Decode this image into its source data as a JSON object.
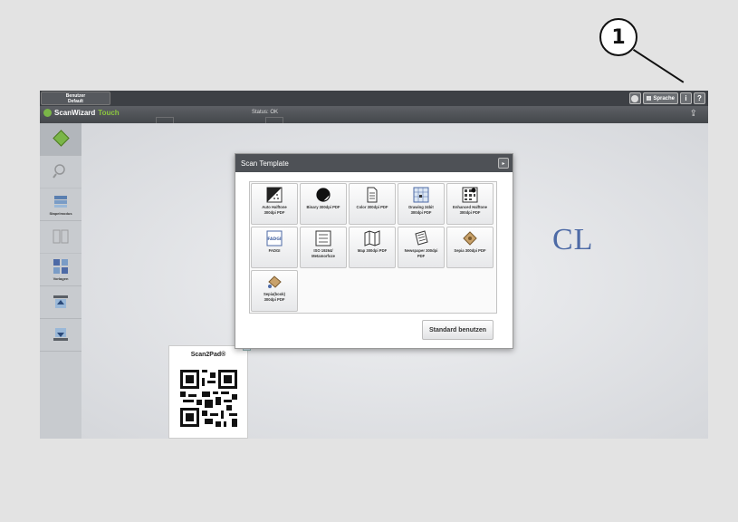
{
  "callout": {
    "number": "1"
  },
  "topbar": {
    "user_label_line1": "Benutzer",
    "user_label_line2": "Default",
    "sprache_label": "Sprache",
    "icons": [
      "settings-icon",
      "language-icon",
      "info-icon",
      "help-icon"
    ]
  },
  "toolbar": {
    "brand": "ScanWizard",
    "brand_accent": "Touch",
    "status": "Status: OK"
  },
  "sidebar": {
    "items": [
      {
        "label": "",
        "icon": "scan-start-icon"
      },
      {
        "label": "",
        "icon": "zoom-icon"
      },
      {
        "label": "Stapelmodus",
        "icon": "stack-icon"
      },
      {
        "label": "",
        "icon": "pages-icon"
      },
      {
        "label": "Vorlagen",
        "icon": "templates-icon"
      },
      {
        "label": "",
        "icon": "scan-up-icon"
      },
      {
        "label": "",
        "icon": "scan-down-icon"
      }
    ]
  },
  "canvas": {
    "bg_letters": "CL"
  },
  "scan2pad": {
    "title": "Scan2Pad®"
  },
  "dialog": {
    "title": "Scan Template",
    "templates": [
      {
        "line1": "Auto Halftone",
        "line2": "300dpi PDF",
        "icon": "halftone-icon"
      },
      {
        "line1": "Binary 300dpi PDF",
        "line2": "",
        "icon": "binary-icon"
      },
      {
        "line1": "Color 300dpi PDF",
        "line2": "",
        "icon": "document-icon"
      },
      {
        "line1": "Drawing 24bit",
        "line2": "300dpi PDF",
        "icon": "drawing-icon"
      },
      {
        "line1": "Enhanced Halftone",
        "line2": "300dpi PDF",
        "icon": "enhanced-halftone-icon"
      },
      {
        "line1": "FADGI",
        "line2": "",
        "icon": "fadgi-icon"
      },
      {
        "line1": "ISO 19264/",
        "line2": "Metamorfoze",
        "icon": "iso-icon"
      },
      {
        "line1": "Map 300dpi PDF",
        "line2": "",
        "icon": "map-icon"
      },
      {
        "line1": "Newspaper 300dpi",
        "line2": "PDF",
        "icon": "newspaper-icon"
      },
      {
        "line1": "Sepia 300dpi PDF",
        "line2": "",
        "icon": "sepia-icon"
      },
      {
        "line1": "Sepia(book)",
        "line2": "300dpi PDF",
        "icon": "sepia-book-icon"
      }
    ],
    "standard_button": "Standard benutzen"
  }
}
